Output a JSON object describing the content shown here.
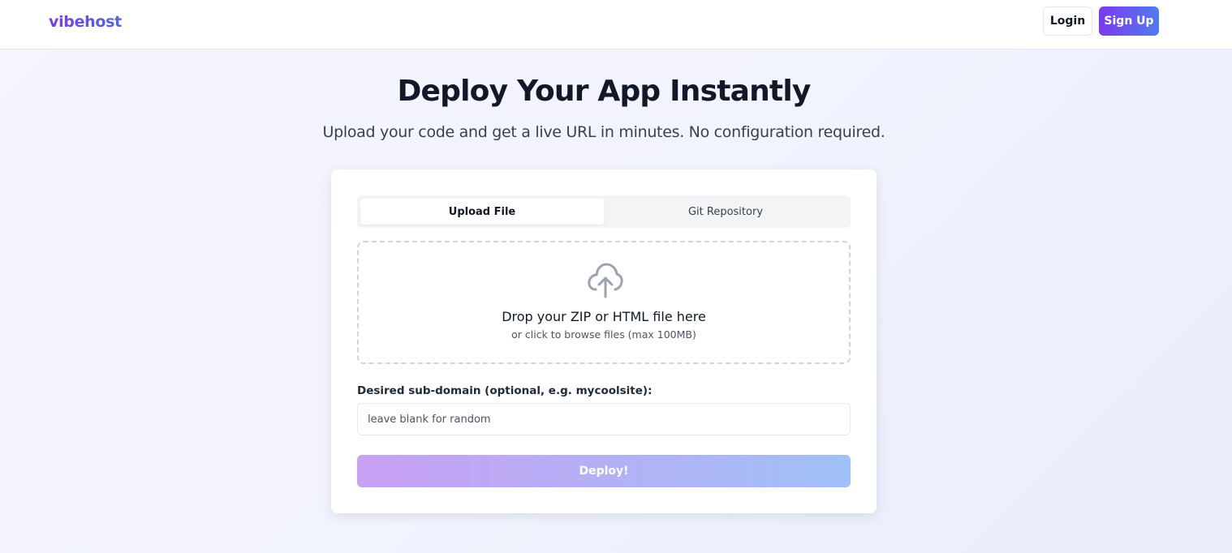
{
  "header": {
    "logo_text": "vibehost",
    "login_label": "Login",
    "signup_label": "Sign Up"
  },
  "hero": {
    "title": "Deploy Your App Instantly",
    "subtitle": "Upload your code and get a live URL in minutes. No configuration required."
  },
  "tabs": [
    {
      "label": "Upload File",
      "active": true
    },
    {
      "label": "Git Repository",
      "active": false
    }
  ],
  "dropzone": {
    "icon": "cloud-upload-icon",
    "title": "Drop your ZIP or HTML file here",
    "hint": "or click to browse files (max 100MB)"
  },
  "subdomain": {
    "label": "Desired sub-domain (optional, e.g. mycoolsite):",
    "placeholder": "leave blank for random",
    "value": ""
  },
  "deploy": {
    "label": "Deploy!",
    "disabled": true
  },
  "colors": {
    "brand_start": "#7c3aed",
    "brand_end": "#4f7bf2",
    "text_primary": "#111827",
    "deploy_disabled_start": "#c9a0f4",
    "deploy_disabled_end": "#9fc0f8"
  }
}
